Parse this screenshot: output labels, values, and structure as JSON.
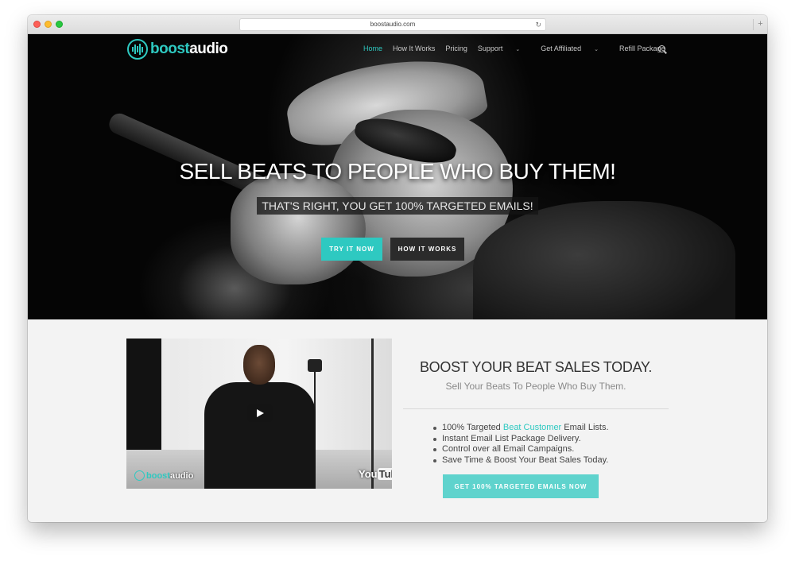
{
  "browser": {
    "url": "boostaudio.com",
    "new_tab_label": "+"
  },
  "brand": {
    "logo_part1": "boost",
    "logo_part2": "audio",
    "accent_color": "#2ec9c1"
  },
  "nav": {
    "items": [
      {
        "label": "Home",
        "active": true
      },
      {
        "label": "How It Works"
      },
      {
        "label": "Pricing"
      },
      {
        "label": "Support",
        "dropdown": true
      },
      {
        "label": "Get Affiliated",
        "dropdown": true
      },
      {
        "label": "Refill Package"
      }
    ],
    "search_icon": "search-icon"
  },
  "hero": {
    "title": "SELL BEATS TO PEOPLE WHO BUY THEM!",
    "subtitle": "THAT'S RIGHT, YOU GET 100% TARGETED EMAILS!",
    "primary_button": "TRY IT NOW",
    "secondary_button": "HOW IT WORKS"
  },
  "video": {
    "overlay_logo_part1": "boost",
    "overlay_logo_part2": "audio",
    "youtube_you": "You",
    "youtube_tube": "Tube",
    "play_icon": "play-icon"
  },
  "section": {
    "title": "BOOST YOUR BEAT SALES TODAY.",
    "subtitle": "Sell Your Beats To People Who Buy Them.",
    "features": [
      {
        "pre": "100% Targeted ",
        "highlight": "Beat Customer",
        "post": " Email Lists."
      },
      {
        "pre": "Instant Email List Package Delivery.",
        "highlight": "",
        "post": ""
      },
      {
        "pre": "Control over all Email Campaigns.",
        "highlight": "",
        "post": ""
      },
      {
        "pre": "Save Time & Boost Your Beat Sales Today.",
        "highlight": "",
        "post": ""
      }
    ],
    "cta_button": "GET 100% TARGETED EMAILS NOW"
  }
}
